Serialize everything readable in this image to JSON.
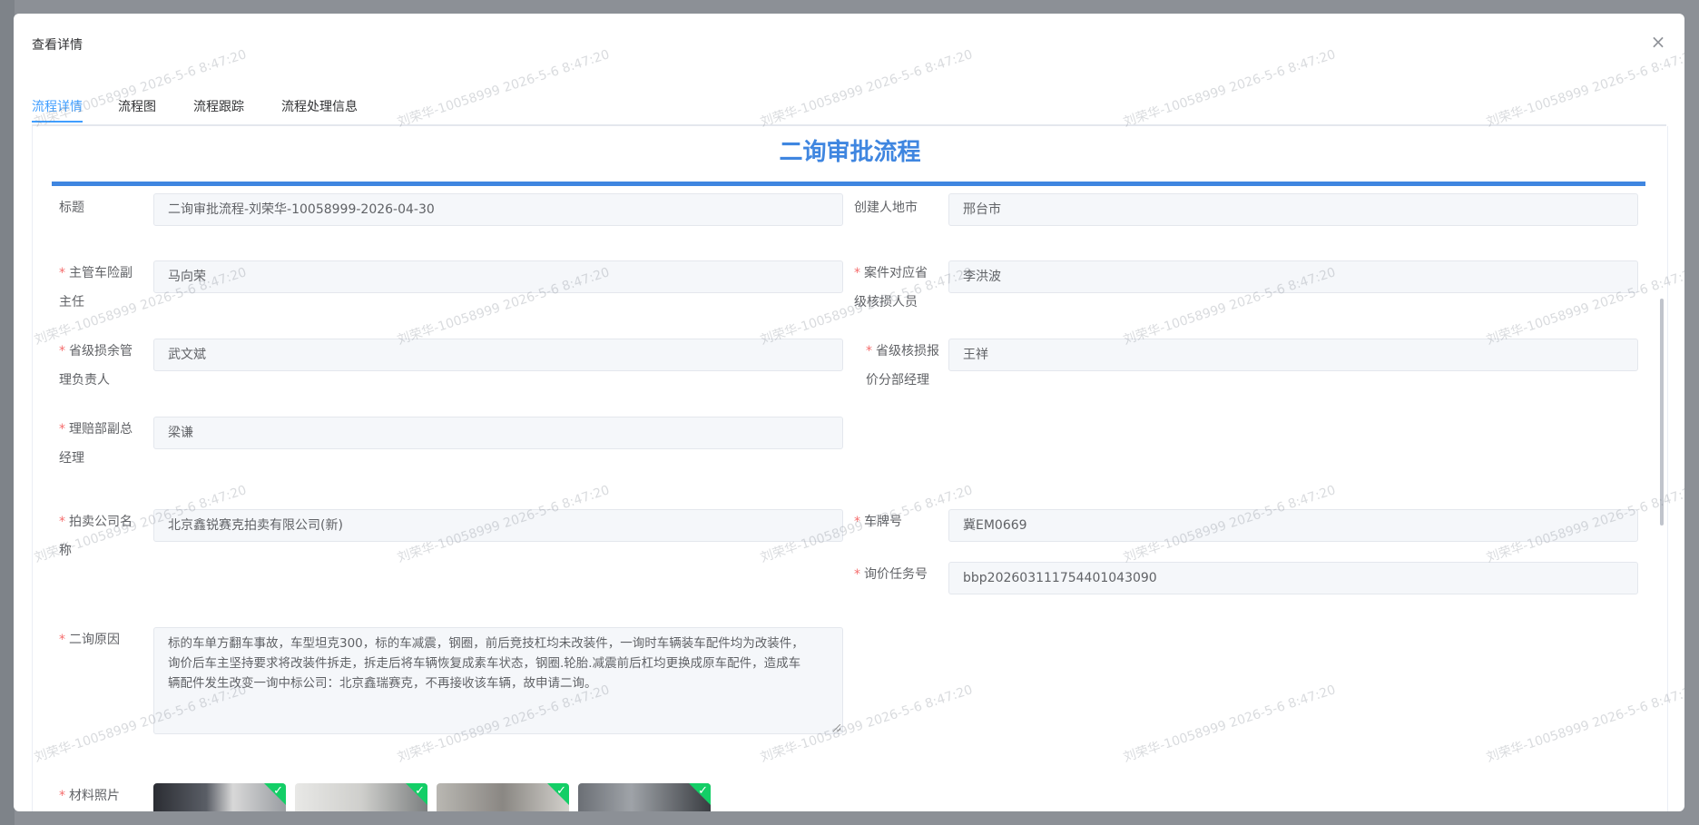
{
  "dialog": {
    "title": "查看详情"
  },
  "tabs": [
    {
      "label": "流程详情"
    },
    {
      "label": "流程图"
    },
    {
      "label": "流程跟踪"
    },
    {
      "label": "流程处理信息"
    }
  ],
  "form": {
    "heading": "二询审批流程",
    "fields": {
      "title": {
        "label": "标题",
        "value": "二询审批流程-刘荣华-10058999-2026-04-30"
      },
      "creator_city": {
        "label": "创建人地市",
        "value": "邢台市"
      },
      "deputy_director": {
        "label_line1": "主管车险副",
        "label_line2": "主任",
        "value": "马向荣"
      },
      "provincial_adjuster": {
        "label_line1": "案件对应省",
        "label_line2": "级核损人员",
        "value": "李洪波"
      },
      "salvage_manager": {
        "label_line1": "省级损余管",
        "label_line2": "理负责人",
        "value": "武文斌"
      },
      "quote_manager": {
        "label_line1": "省级核损报",
        "label_line2": "价分部经理",
        "value": "王祥"
      },
      "claims_deputy": {
        "label_line1": "理赔部副总",
        "label_line2": "经理",
        "value": "梁谦"
      },
      "auction_company": {
        "label_line1": "拍卖公司名",
        "label_line2": "称",
        "value": "北京鑫锐赛克拍卖有限公司(新)"
      },
      "plate_number": {
        "label": "车牌号",
        "value": "冀EM0669"
      },
      "inquiry_task_no": {
        "label": "询价任务号",
        "value": "bbp202603111754401043090"
      },
      "reason": {
        "label": "二询原因",
        "line1": "标的车单方翻车事故，车型坦克300，标的车减震，钢圈，前后竞技杠均未改装件，一询时车辆装车配件均为改装件，",
        "line2": "询价后车主坚持要求将改装件拆走，拆走后将车辆恢复成素车状态，钢圈.轮胎.减震前后杠均更换成原车配件，造成车",
        "line3": "辆配件发生改变一询中标公司：北京鑫瑞赛克，不再接收该车辆，故申请二询。"
      },
      "photos": {
        "label": "材料照片"
      }
    }
  },
  "watermark": {
    "text": "刘荣华-10058999   2026-5-6 8:47:20"
  },
  "colors": {
    "accent": "#409eff",
    "heading": "#3f86e0",
    "required": "#f56c6c",
    "check": "#13ce66"
  }
}
